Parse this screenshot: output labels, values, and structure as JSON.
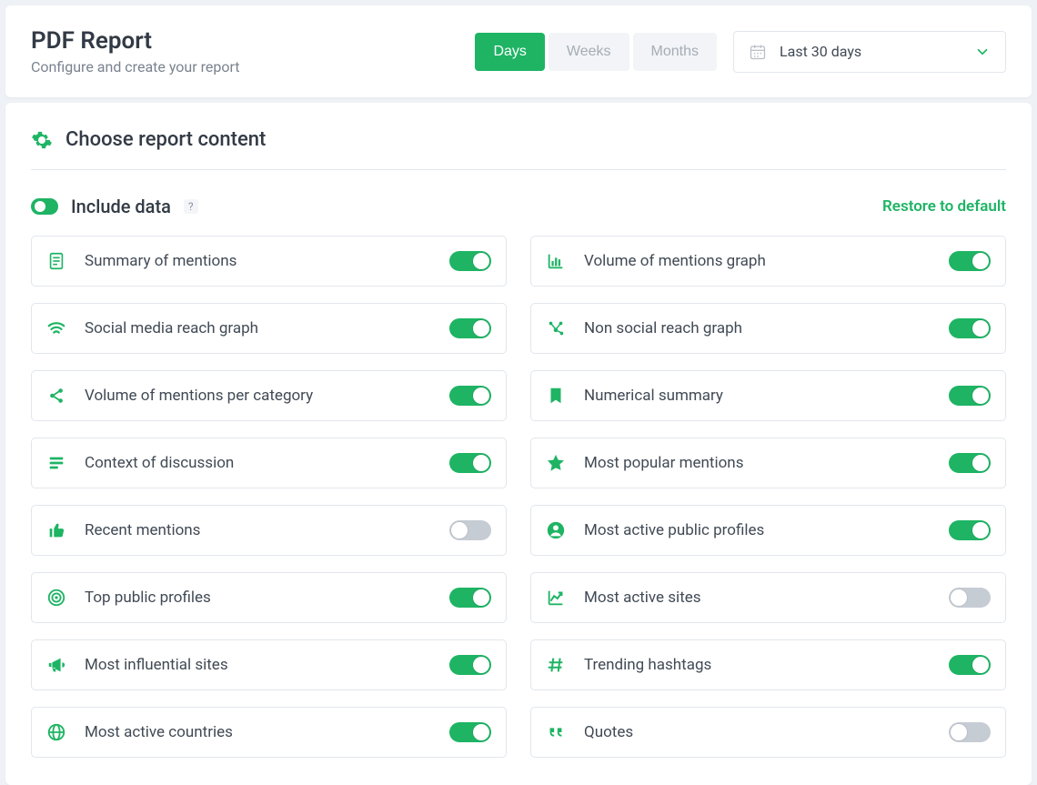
{
  "header": {
    "title": "PDF Report",
    "subtitle": "Configure and create your report",
    "granularity": {
      "options": [
        "Days",
        "Weeks",
        "Months"
      ],
      "selected": "Days"
    },
    "date_range": "Last 30 days"
  },
  "section_title": "Choose report content",
  "include_data": {
    "label": "Include data",
    "enabled": true,
    "help": "?"
  },
  "restore_label": "Restore to default",
  "items": [
    {
      "id": "summary-mentions",
      "icon": "file",
      "label": "Summary of mentions",
      "enabled": true
    },
    {
      "id": "volume-mentions-graph",
      "icon": "bar-chart",
      "label": "Volume of mentions graph",
      "enabled": true
    },
    {
      "id": "social-reach-graph",
      "icon": "wifi",
      "label": "Social media reach graph",
      "enabled": true
    },
    {
      "id": "non-social-reach-graph",
      "icon": "network",
      "label": "Non social reach graph",
      "enabled": true
    },
    {
      "id": "volume-per-category",
      "icon": "share",
      "label": "Volume of mentions per category",
      "enabled": true
    },
    {
      "id": "numerical-summary",
      "icon": "bookmark",
      "label": "Numerical summary",
      "enabled": true
    },
    {
      "id": "context-discussion",
      "icon": "lines",
      "label": "Context of discussion",
      "enabled": true
    },
    {
      "id": "popular-mentions",
      "icon": "star",
      "label": "Most popular mentions",
      "enabled": true
    },
    {
      "id": "recent-mentions",
      "icon": "thumb",
      "label": "Recent mentions",
      "enabled": false
    },
    {
      "id": "active-public-profiles",
      "icon": "user",
      "label": "Most active public profiles",
      "enabled": true
    },
    {
      "id": "top-public-profiles",
      "icon": "target",
      "label": "Top public profiles",
      "enabled": true
    },
    {
      "id": "active-sites",
      "icon": "line-chart",
      "label": "Most active sites",
      "enabled": false
    },
    {
      "id": "influential-sites",
      "icon": "megaphone",
      "label": "Most influential sites",
      "enabled": true
    },
    {
      "id": "trending-hashtags",
      "icon": "hash",
      "label": "Trending hashtags",
      "enabled": true
    },
    {
      "id": "active-countries",
      "icon": "globe",
      "label": "Most active countries",
      "enabled": true
    },
    {
      "id": "quotes",
      "icon": "quote",
      "label": "Quotes",
      "enabled": false
    }
  ],
  "colors": {
    "accent": "#1eb464"
  }
}
